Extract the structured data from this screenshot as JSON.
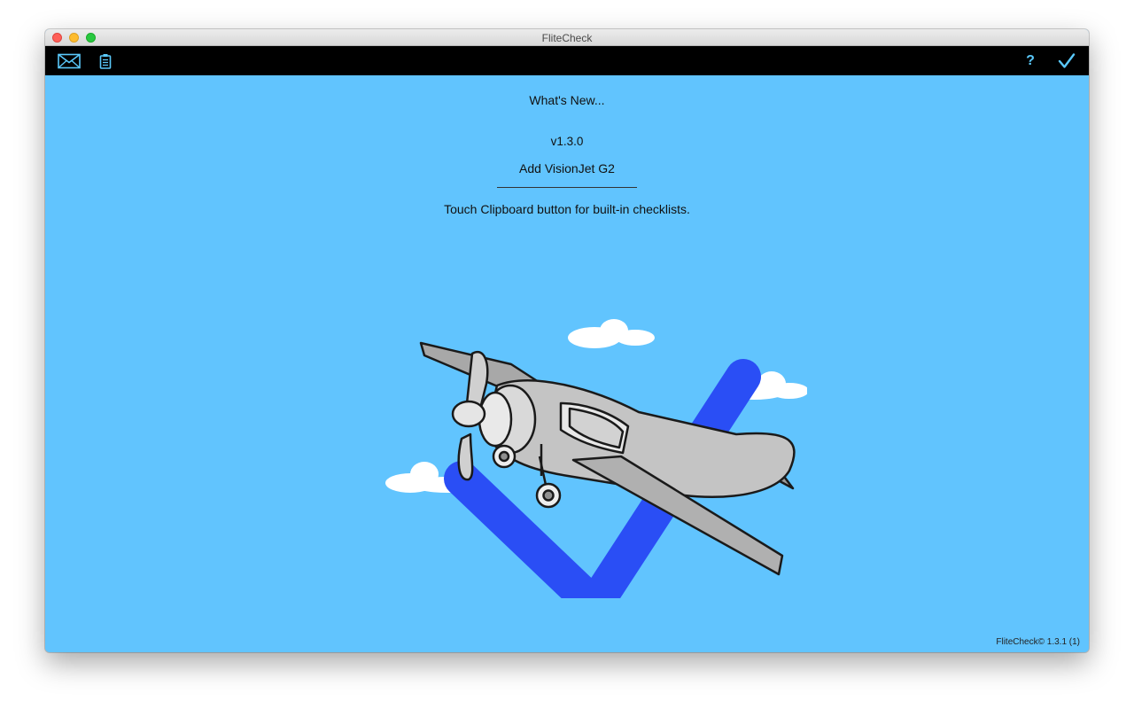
{
  "window": {
    "title": "FliteCheck"
  },
  "toolbar": {
    "mail_icon": "envelope-icon",
    "clipboard_icon": "clipboard-icon",
    "help_label": "?",
    "done_icon": "checkmark-icon",
    "accent_color": "#5ac8fa"
  },
  "content": {
    "heading": "What's New...",
    "version": "v1.3.0",
    "change_item": "Add VisionJet G2",
    "hint": "Touch Clipboard button for built-in checklists.",
    "background_color": "#61c4fe"
  },
  "illustration": {
    "checkmark_color": "#2a4ef5",
    "plane_color": "#bdbdbd"
  },
  "footer": {
    "copyright": "FliteCheck© 1.3.1 (1)"
  }
}
